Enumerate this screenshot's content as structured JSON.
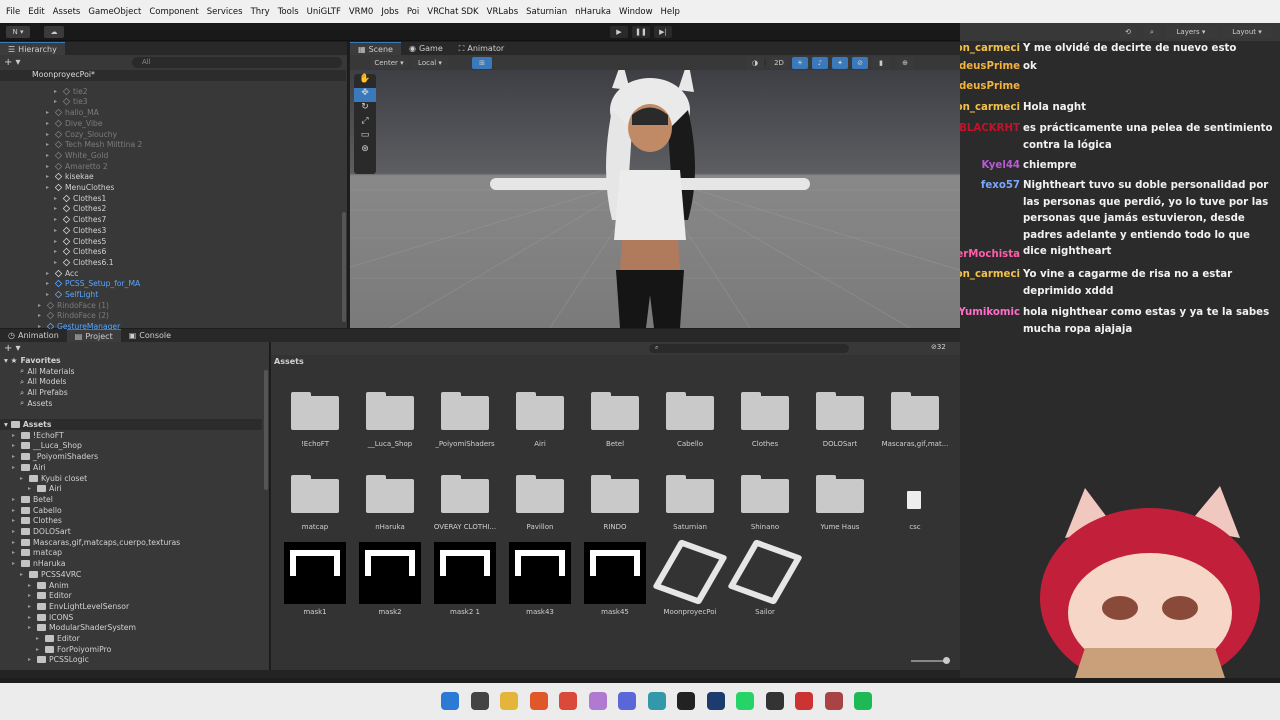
{
  "menu": [
    "File",
    "Edit",
    "Assets",
    "GameObject",
    "Component",
    "Services",
    "Thry",
    "Tools",
    "UniGLTF",
    "VRM0",
    "Jobs",
    "Poi",
    "VRChat SDK",
    "VRLabs",
    "Saturnian",
    "nHaruka",
    "Window",
    "Help"
  ],
  "toolbar": {
    "account": "N",
    "layers": "Layers",
    "layout": "Layout"
  },
  "hierarchy": {
    "tab": "Hierarchy",
    "search_placeholder": "All",
    "root": "MoonproyecPoi*",
    "items": [
      {
        "label": "tie2",
        "dim": true,
        "indent": 3
      },
      {
        "label": "tie3",
        "dim": true,
        "indent": 3
      },
      {
        "label": "hallo_MA",
        "dim": true,
        "indent": 2
      },
      {
        "label": "Dive_Vibe",
        "dim": true,
        "indent": 2
      },
      {
        "label": "Cozy_Slouchy",
        "dim": true,
        "indent": 2
      },
      {
        "label": "Tech Mesh Milttina 2",
        "dim": true,
        "indent": 2
      },
      {
        "label": "White_Gold",
        "dim": true,
        "indent": 2
      },
      {
        "label": "Amaretto 2",
        "dim": true,
        "indent": 2
      },
      {
        "label": "kisekae",
        "dim": false,
        "indent": 2
      },
      {
        "label": "MenuClothes",
        "dim": false,
        "indent": 2
      },
      {
        "label": "Clothes1",
        "dim": false,
        "indent": 3
      },
      {
        "label": "Clothes2",
        "dim": false,
        "indent": 3
      },
      {
        "label": "Clothes7",
        "dim": false,
        "indent": 3
      },
      {
        "label": "Clothes3",
        "dim": false,
        "indent": 3
      },
      {
        "label": "Clothes5",
        "dim": false,
        "indent": 3
      },
      {
        "label": "Clothes6",
        "dim": false,
        "indent": 3
      },
      {
        "label": "Clothes6.1",
        "dim": false,
        "indent": 3
      },
      {
        "label": "Acc",
        "dim": false,
        "indent": 2
      },
      {
        "label": "PCSS_Setup_for_MA",
        "blue": true,
        "indent": 2
      },
      {
        "label": "SelfLight",
        "blue": true,
        "indent": 2
      },
      {
        "label": "RindoFace (1)",
        "dim": true,
        "indent": 1
      },
      {
        "label": "RindoFace (2)",
        "dim": true,
        "indent": 1
      },
      {
        "label": "GestureManager",
        "blue": true,
        "indent": 1
      }
    ]
  },
  "scene": {
    "tabs": [
      "Scene",
      "Game",
      "Animator"
    ],
    "pivot": "Center",
    "space": "Local",
    "mode2d": "2D"
  },
  "bottom_tabs": [
    "Animation",
    "Project",
    "Console"
  ],
  "project": {
    "favorites_label": "Favorites",
    "favorites": [
      "All Materials",
      "All Models",
      "All Prefabs",
      "Assets"
    ],
    "assets_label": "Assets",
    "tree": [
      {
        "label": "!EchoFT",
        "indent": 1
      },
      {
        "label": "__Luca_Shop",
        "indent": 1
      },
      {
        "label": "_PoiyomiShaders",
        "indent": 1
      },
      {
        "label": "Airi",
        "indent": 1
      },
      {
        "label": "Kyubi closet",
        "indent": 2
      },
      {
        "label": "Airi",
        "indent": 3
      },
      {
        "label": "Betel",
        "indent": 1
      },
      {
        "label": "Cabello",
        "indent": 1
      },
      {
        "label": "Clothes",
        "indent": 1
      },
      {
        "label": "DOLOSart",
        "indent": 1
      },
      {
        "label": "Mascaras,gif,matcaps,cuerpo,texturas",
        "indent": 1
      },
      {
        "label": "matcap",
        "indent": 1
      },
      {
        "label": "nHaruka",
        "indent": 1
      },
      {
        "label": "PCSS4VRC",
        "indent": 2
      },
      {
        "label": "Anim",
        "indent": 3
      },
      {
        "label": "Editor",
        "indent": 3
      },
      {
        "label": "EnvLightLevelSensor",
        "indent": 3
      },
      {
        "label": "ICONS",
        "indent": 3
      },
      {
        "label": "ModularShaderSystem",
        "indent": 3
      },
      {
        "label": "Editor",
        "indent": 4
      },
      {
        "label": "ForPoiyomiPro",
        "indent": 4
      },
      {
        "label": "PCSSLogic",
        "indent": 3
      }
    ],
    "breadcrumb": "Assets",
    "hidden_count": "32",
    "row1": [
      "!EchoFT",
      "__Luca_Shop",
      "_PoiyomiShaders",
      "Airi",
      "Betel",
      "Cabello",
      "Clothes",
      "DOLOSart",
      "Mascaras,gif,mat..."
    ],
    "row2": [
      "matcap",
      "nHaruka",
      "OVERAY CLOTHI...",
      "Pavillon",
      "RINDO",
      "Saturnian",
      "Shinano",
      "Yume Haus",
      "csc"
    ],
    "row3": [
      "mask1",
      "mask2",
      "mask2 1",
      "mask43",
      "mask45",
      "MoonproyecPoi",
      "Sailor"
    ]
  },
  "chat": [
    {
      "name": "Demon_carmeci",
      "color": "#f3c24a",
      "msg": "Y me olvidé de decirte de nuevo esto",
      "badge": ""
    },
    {
      "name": "asmodeusPrime",
      "color": "#f4b23e",
      "msg": "ok",
      "badge": "✦"
    },
    {
      "name": "asmodeusPrime",
      "color": "#f4b23e",
      "msg": "",
      "badge": "✦"
    },
    {
      "name": "Demon_carmeci",
      "color": "#f3c24a",
      "msg": "Hola naght",
      "badge": ""
    },
    {
      "name": "BLACKRHT",
      "color": "#c0142b",
      "msg": "es prácticamente una pelea de sentimiento contra la lógica",
      "badge": ""
    },
    {
      "name": "Kyel44",
      "color": "#b85bd4",
      "msg": "chiempre",
      "badge": "✦"
    },
    {
      "name": "fexo57",
      "color": "#7aa8ff",
      "msg": "Nightheart tuvo su doble personalidad por las personas que perdió, yo lo tuve por las personas que jamás estuvieron, desde padres adelante y entiendo todo lo que dice nightheart",
      "badge": ""
    },
    {
      "name": "MisterMochista",
      "color": "#ff5ea8",
      "msg": "",
      "badge": "✦"
    },
    {
      "name": "Demon_carmeci",
      "color": "#f3c24a",
      "msg": "Yo vine a cagarme de risa no a estar deprimido xddd",
      "badge": ""
    },
    {
      "name": "Yumikomic",
      "color": "#ff6ec7",
      "msg": "hola nighthear como estas y ya te la sabes mucha ropa ajajaja",
      "badge": ""
    }
  ],
  "taskbar_icons": [
    "windows-icon",
    "search-icon",
    "file-explorer-icon",
    "brave-icon",
    "chrome-icon",
    "cat-icon",
    "discord-icon",
    "terminal-icon",
    "unity-icon",
    "photoshop-icon",
    "whatsapp-icon",
    "unity-hub-icon",
    "app-icon",
    "app2-icon",
    "spotify-icon"
  ]
}
